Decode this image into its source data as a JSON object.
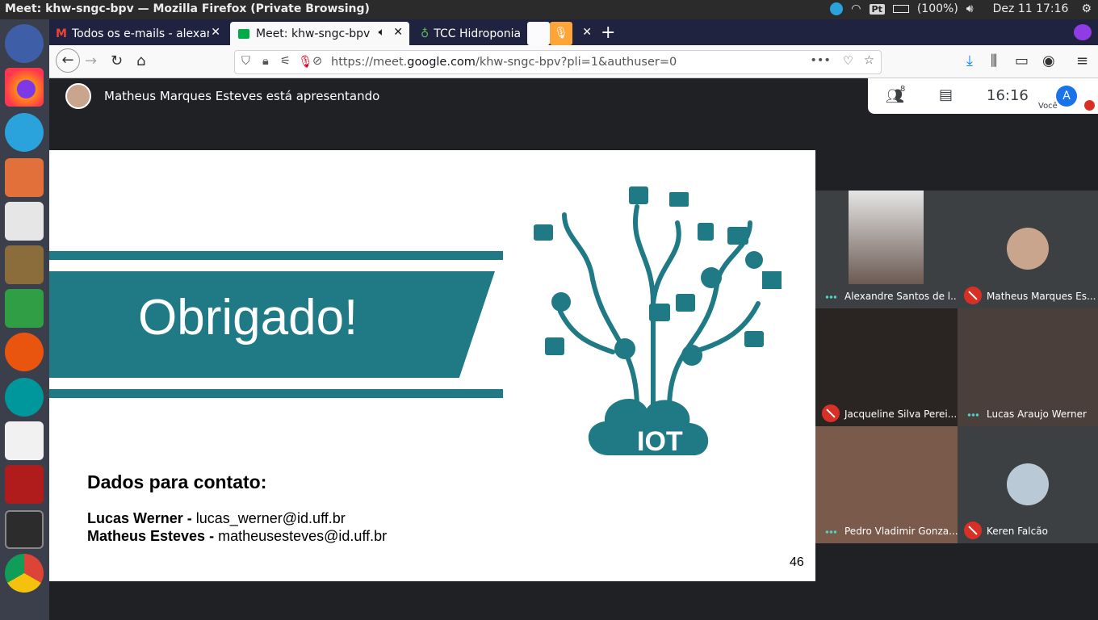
{
  "os_topbar": {
    "window_title": "Meet: khw-sngc-bpv — Mozilla Firefox (Private Browsing)",
    "keyboard_layout": "Pt",
    "battery": "(100%)",
    "clock": "Dez 11 17:16"
  },
  "tabs": [
    {
      "label": "Todos os e-mails - alexan",
      "icon": "gmail-icon"
    },
    {
      "label": "Meet: khw-sngc-bpv",
      "icon": "meet-icon",
      "active": true
    },
    {
      "label": "TCC Hidroponia -",
      "icon": "hydroponics-icon"
    }
  ],
  "url": {
    "prefix": "https://meet.",
    "domain": "google.com",
    "path": "/khw-sngc-bpv?pli=1&authuser=0"
  },
  "meet": {
    "presenter_text": "Matheus Marques Esteves está apresentando",
    "participants_count": "8",
    "time": "16:16",
    "self_initial": "A",
    "self_label": "Você"
  },
  "slide": {
    "title": "Obrigado!",
    "iot_label": "IOT",
    "contact_heading": "Dados para contato:",
    "contacts": [
      {
        "name": "Lucas Werner",
        "email": "lucas_werner@id.uff.br"
      },
      {
        "name": "Matheus Esteves",
        "email": "matheusesteves@id.uff.br"
      }
    ],
    "separator": " - ",
    "page_number": "46"
  },
  "participants": [
    {
      "name": "Alexandre Santos de l...",
      "status": "speaking"
    },
    {
      "name": "Matheus Marques Es...",
      "status": "muted"
    },
    {
      "name": "Jacqueline Silva Perei...",
      "status": "muted"
    },
    {
      "name": "Lucas Araujo Werner",
      "status": "speaking"
    },
    {
      "name": "Pedro Vladimir Gonza...",
      "status": "speaking"
    },
    {
      "name": "Keren Falcão",
      "status": "muted"
    }
  ],
  "colors": {
    "teal": "#1f7a85",
    "meet_bg": "#202124",
    "tile_bg": "#3c4043",
    "mute_red": "#d93025",
    "accent_blue": "#1a73e8"
  }
}
